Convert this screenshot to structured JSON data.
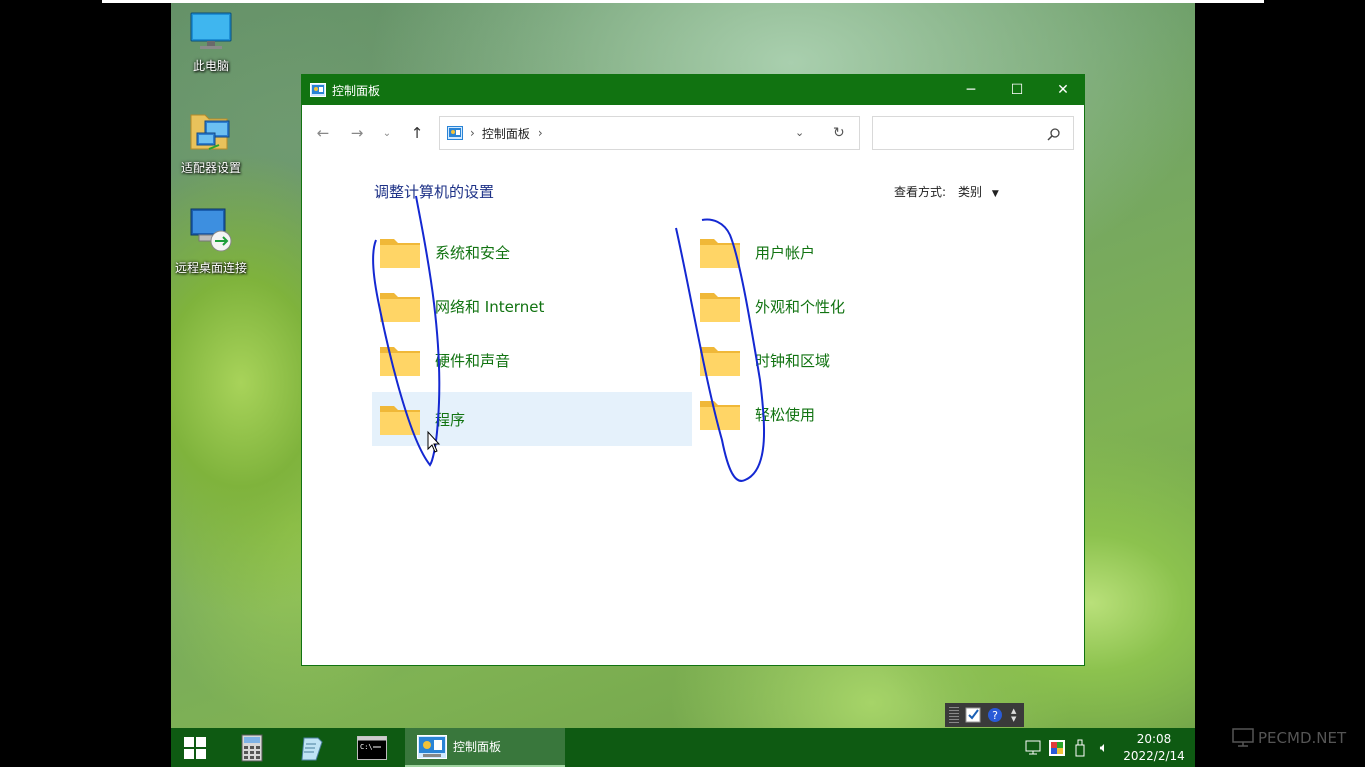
{
  "desktop": {
    "icons": [
      {
        "label": "此电脑"
      },
      {
        "label": "适配器设置"
      },
      {
        "label": "远程桌面连接"
      }
    ]
  },
  "window": {
    "title": "控制面板",
    "controls": {
      "minimize": "─",
      "maximize": "☐",
      "close": "✕"
    },
    "address": {
      "crumb": "控制面板",
      "sep": "›"
    },
    "search_placeholder": "",
    "heading": "调整计算机的设置",
    "view_by": {
      "label": "查看方式:",
      "value": "类别"
    },
    "categories_left": [
      {
        "label": "系统和安全"
      },
      {
        "label": "网络和 Internet"
      },
      {
        "label": "硬件和声音"
      },
      {
        "label": "程序"
      }
    ],
    "categories_right": [
      {
        "label": "用户帐户"
      },
      {
        "label": "外观和个性化"
      },
      {
        "label": "时钟和区域"
      },
      {
        "label": "轻松使用"
      }
    ]
  },
  "taskbar": {
    "active_app_label": "控制面板",
    "clock": {
      "time": "20:08",
      "date": "2022/2/14"
    }
  },
  "watermark": {
    "text": "PECMD.NET"
  },
  "colors": {
    "accent": "#117311",
    "taskbar": "#0e5a12",
    "heading": "#1e3287",
    "selection": "#e5f1fb"
  }
}
